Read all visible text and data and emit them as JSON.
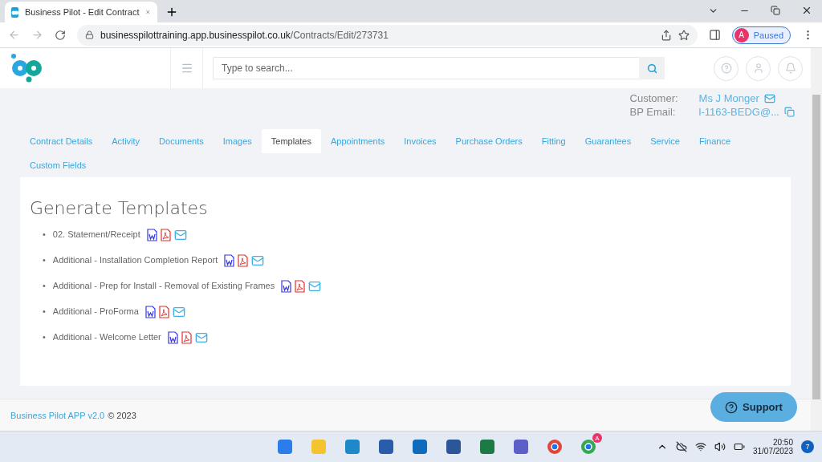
{
  "browser": {
    "tab_title": "Business Pilot - Edit Contract",
    "url_host": "businesspilottraining.app.businesspilot.co.uk",
    "url_path": "/Contracts/Edit/273731",
    "profile_initial": "A",
    "profile_status": "Paused"
  },
  "header": {
    "search_placeholder": "Type to search..."
  },
  "info": [
    {
      "label": "Customer:",
      "value": "Ms J Monger",
      "kind": "email"
    },
    {
      "label": "BP Email:",
      "value": "l-1163-BEDG@...",
      "kind": "copy"
    }
  ],
  "tabs": [
    {
      "label": "Contract Details",
      "selected": false
    },
    {
      "label": "Activity",
      "selected": false
    },
    {
      "label": "Documents",
      "selected": false
    },
    {
      "label": "Images",
      "selected": false
    },
    {
      "label": "Templates",
      "selected": true
    },
    {
      "label": "Appointments",
      "selected": false
    },
    {
      "label": "Invoices",
      "selected": false
    },
    {
      "label": "Purchase Orders",
      "selected": false
    },
    {
      "label": "Fitting",
      "selected": false
    },
    {
      "label": "Guarantees",
      "selected": false
    },
    {
      "label": "Service",
      "selected": false
    },
    {
      "label": "Finance",
      "selected": false
    },
    {
      "label": "Custom Fields",
      "selected": false
    }
  ],
  "panel": {
    "title": "Generate Templates",
    "bullet": "•",
    "templates": [
      "02. Statement/Receipt",
      "Additional - Installation Completion Report",
      "Additional - Prep for Install - Removal of Existing Frames",
      "Additional - ProForma",
      "Additional - Welcome Letter"
    ]
  },
  "footer": {
    "link": "Business Pilot APP v2.0",
    "copyright": "© 2023",
    "support": "Support"
  },
  "taskbar": {
    "time": "20:50",
    "date": "31/07/2023",
    "notifications": "7",
    "chrome_badge": "A"
  }
}
